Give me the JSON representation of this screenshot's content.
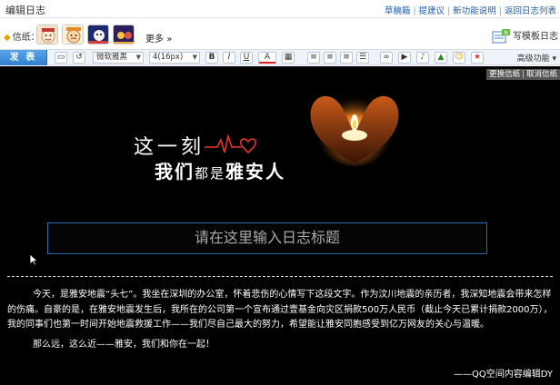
{
  "page": {
    "title": "编辑日志"
  },
  "top_links": [
    "草稿箱",
    "提建议",
    "新功能说明",
    "返回日志列表"
  ],
  "stationery": {
    "label": "信纸：",
    "more_label": "更多",
    "template_label": "写模板日志"
  },
  "toolbar": {
    "publish_label": "发 表",
    "font_family": "微软雅黑",
    "font_size": "4(16px)",
    "bold_glyph": "B",
    "italic_glyph": "I",
    "underline_glyph": "U",
    "color_glyph": "A",
    "advanced_label": "高级功能"
  },
  "editor": {
    "stationery_actions": [
      "更换信纸",
      "取消信纸"
    ],
    "banner_line1": "这一刻",
    "banner_line2a": "我们",
    "banner_line2b": "都",
    "banner_line2c": "是",
    "banner_line2d": "雅安人",
    "title_placeholder": "请在这里输入日志标题",
    "paragraph1": "今天，是雅安地震“头七”。我坐在深圳的办公室，怀着悲伤的心情写下这段文字。作为汶川地震的亲历者，我深知地震会带来怎样的伤痛。自豪的是，在雅安地震发生后，我所在的公司第一个宣布通过壹基金向灾区捐款500万人民币（截止今天已累计捐款2000万），我的同事们也第一时间开始地震救援工作——我们尽自己最大的努力，希望能让雅安同胞感受到亿万网友的关心与温暖。",
    "paragraph2": "那么远，这么近——雅安，我们和你在一起！",
    "signature": "——QQ空间内容编辑DY"
  },
  "colors": {
    "link": "#1f5fa8",
    "publish_button": "#2f7fd0",
    "editor_background": "#000000",
    "title_border": "#2a6ab0",
    "heartbeat": "#e8352a"
  }
}
